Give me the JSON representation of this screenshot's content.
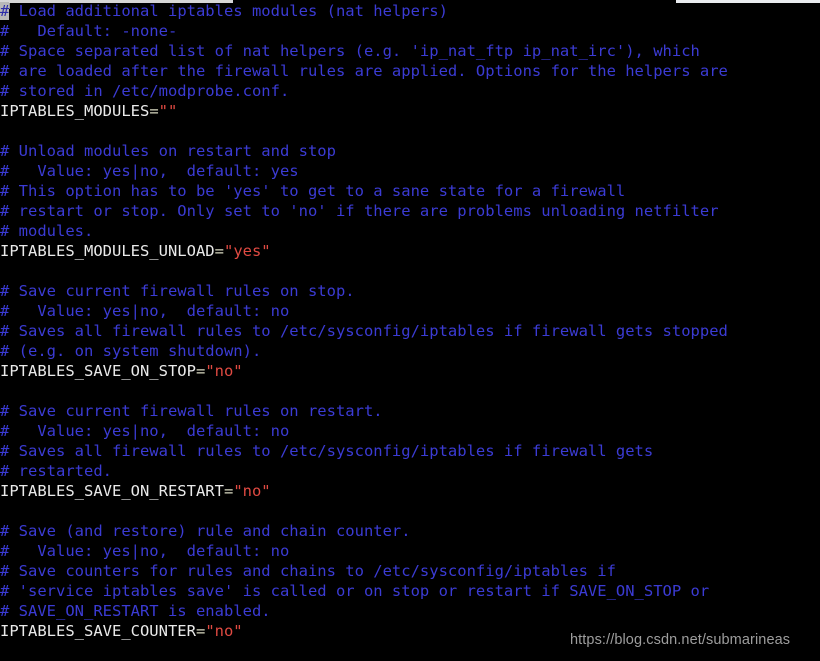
{
  "window": {
    "chrome_visible": true
  },
  "terminal": {
    "background": "#000000",
    "comment_color": "#3b3bd4",
    "variable_color": "#eaeaea",
    "value_color": "#e04a42",
    "cursor_color": "#b8b8b8",
    "cursor_char": "#",
    "lines": [
      {
        "type": "comment",
        "text": "# Load additional iptables modules (nat helpers)",
        "cursor": true
      },
      {
        "type": "comment",
        "text": "#   Default: -none-"
      },
      {
        "type": "comment",
        "text": "# Space separated list of nat helpers (e.g. 'ip_nat_ftp ip_nat_irc'), which"
      },
      {
        "type": "comment",
        "text": "# are loaded after the firewall rules are applied. Options for the helpers are"
      },
      {
        "type": "comment",
        "text": "# stored in /etc/modprobe.conf."
      },
      {
        "type": "assign",
        "name": "IPTABLES_MODULES",
        "value": "\"\""
      },
      {
        "type": "blank",
        "text": ""
      },
      {
        "type": "comment",
        "text": "# Unload modules on restart and stop"
      },
      {
        "type": "comment",
        "text": "#   Value: yes|no,  default: yes"
      },
      {
        "type": "comment",
        "text": "# This option has to be 'yes' to get to a sane state for a firewall"
      },
      {
        "type": "comment",
        "text": "# restart or stop. Only set to 'no' if there are problems unloading netfilter"
      },
      {
        "type": "comment",
        "text": "# modules."
      },
      {
        "type": "assign",
        "name": "IPTABLES_MODULES_UNLOAD",
        "value": "\"yes\""
      },
      {
        "type": "blank",
        "text": ""
      },
      {
        "type": "comment",
        "text": "# Save current firewall rules on stop."
      },
      {
        "type": "comment",
        "text": "#   Value: yes|no,  default: no"
      },
      {
        "type": "comment",
        "text": "# Saves all firewall rules to /etc/sysconfig/iptables if firewall gets stopped"
      },
      {
        "type": "comment",
        "text": "# (e.g. on system shutdown)."
      },
      {
        "type": "assign",
        "name": "IPTABLES_SAVE_ON_STOP",
        "value": "\"no\""
      },
      {
        "type": "blank",
        "text": ""
      },
      {
        "type": "comment",
        "text": "# Save current firewall rules on restart."
      },
      {
        "type": "comment",
        "text": "#   Value: yes|no,  default: no"
      },
      {
        "type": "comment",
        "text": "# Saves all firewall rules to /etc/sysconfig/iptables if firewall gets"
      },
      {
        "type": "comment",
        "text": "# restarted."
      },
      {
        "type": "assign",
        "name": "IPTABLES_SAVE_ON_RESTART",
        "value": "\"no\""
      },
      {
        "type": "blank",
        "text": ""
      },
      {
        "type": "comment",
        "text": "# Save (and restore) rule and chain counter."
      },
      {
        "type": "comment",
        "text": "#   Value: yes|no,  default: no"
      },
      {
        "type": "comment",
        "text": "# Save counters for rules and chains to /etc/sysconfig/iptables if"
      },
      {
        "type": "comment",
        "text": "# 'service iptables save' is called or on stop or restart if SAVE_ON_STOP or"
      },
      {
        "type": "comment",
        "text": "# SAVE_ON_RESTART is enabled."
      },
      {
        "type": "assign",
        "name": "IPTABLES_SAVE_COUNTER",
        "value": "\"no\""
      }
    ]
  },
  "watermark": {
    "text": "https://blog.csdn.net/submarineas",
    "color": "#9d9d9d"
  }
}
